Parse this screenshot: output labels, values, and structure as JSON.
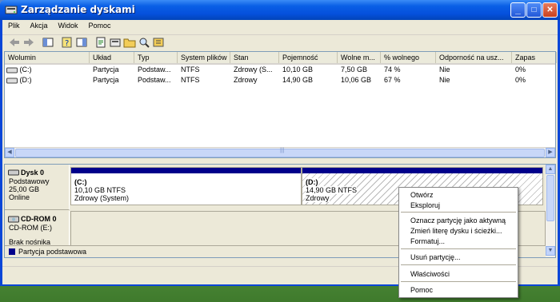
{
  "window": {
    "title": "Zarządzanie dyskami",
    "min": "_",
    "max": "□",
    "close": "✕"
  },
  "menu": [
    "Plik",
    "Akcja",
    "Widok",
    "Pomoc"
  ],
  "volume_list": {
    "columns": [
      "Wolumin",
      "Układ",
      "Typ",
      "System plików",
      "Stan",
      "Pojemność",
      "Wolne m...",
      "% wolnego",
      "Odporność na usz...",
      "Zapas"
    ],
    "rows": [
      [
        "(C:)",
        "Partycja",
        "Podstaw...",
        "NTFS",
        "Zdrowy (S...",
        "10,10 GB",
        "7,50 GB",
        "74 %",
        "Nie",
        "0%"
      ],
      [
        "(D:)",
        "Partycja",
        "Podstaw...",
        "NTFS",
        "Zdrowy",
        "14,90 GB",
        "10,06 GB",
        "67 %",
        "Nie",
        "0%"
      ]
    ],
    "hscroll_grip": "|||"
  },
  "disks": {
    "disk0": {
      "name": "Dysk 0",
      "type": "Podstawowy",
      "size": "25,00 GB",
      "status": "Online",
      "partitions": [
        {
          "label": "(C:)",
          "size_fs": "10,10 GB NTFS",
          "status": "Zdrowy (System)"
        },
        {
          "label": "(D:)",
          "size_fs": "14,90 GB NTFS",
          "status": "Zdrowy"
        }
      ]
    },
    "cdrom0": {
      "name": "CD-ROM 0",
      "drive": "CD-ROM (E:)",
      "media": "Brak nośnika"
    }
  },
  "legend": {
    "primary_partition": "Partycja podstawowa",
    "primary_color": "#00008b"
  },
  "context_menu": {
    "open": "Otwórz",
    "explore": "Eksploruj",
    "mark_active": "Oznacz partycję jako aktywną",
    "change_letter": "Zmień literę dysku i ścieżki...",
    "format": "Formatuj...",
    "delete": "Usuń partycję...",
    "properties": "Właściwości",
    "help": "Pomoc"
  },
  "colors": {
    "titlebar": "#0550dc",
    "selected_partition_bar": "#00008b"
  }
}
